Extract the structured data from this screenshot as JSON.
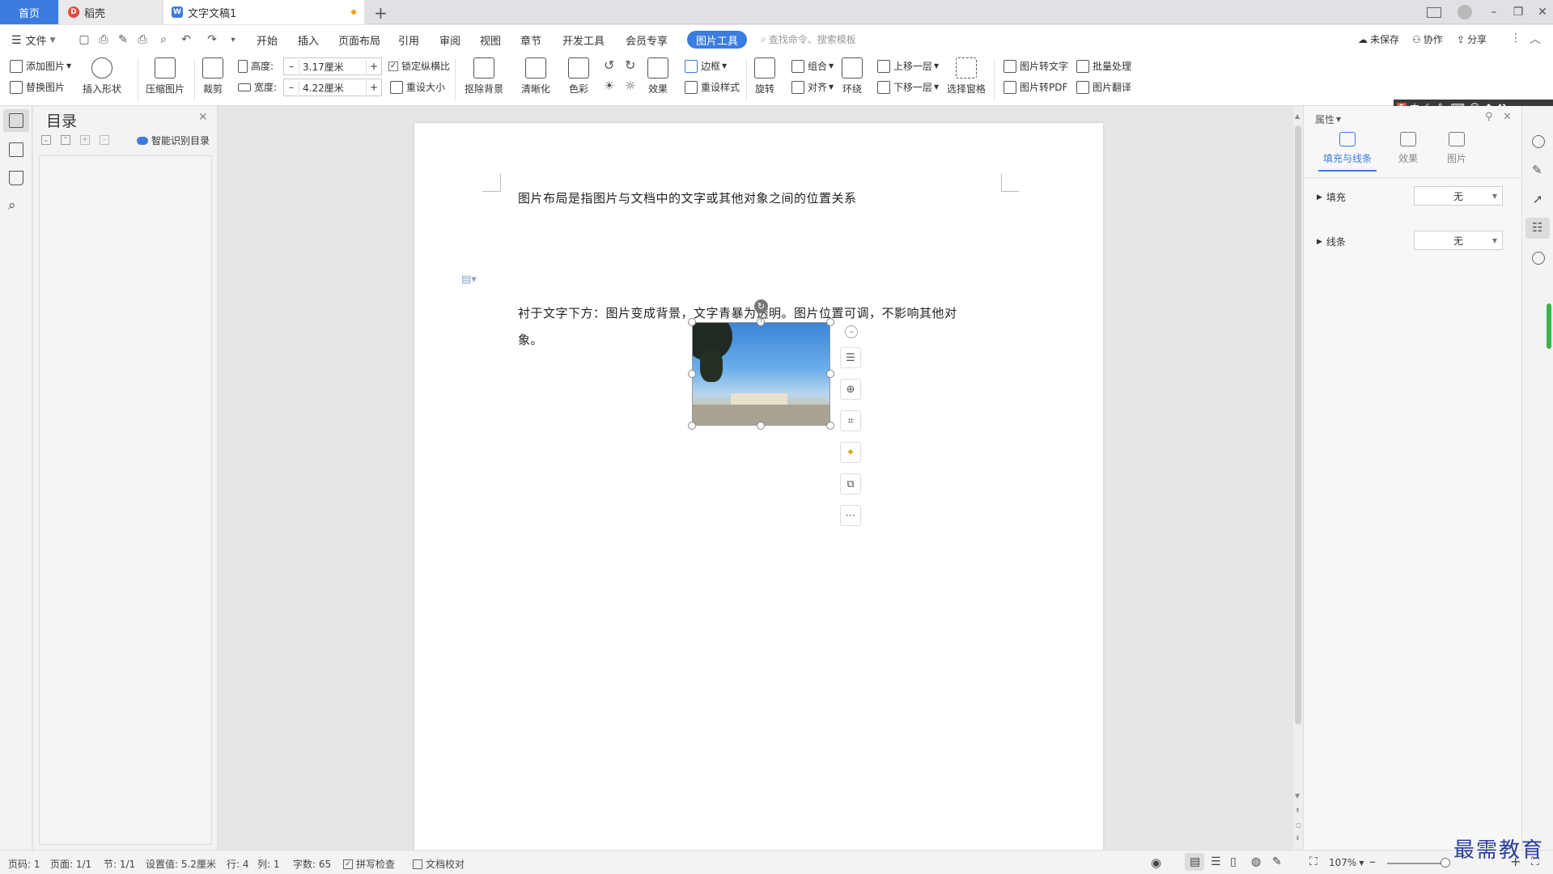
{
  "tabs": {
    "home": "首页",
    "daoke": "稻壳",
    "doc": "文字文稿1"
  },
  "menu": {
    "file": "文件",
    "items": [
      "开始",
      "插入",
      "页面布局",
      "引用",
      "审阅",
      "视图",
      "章节",
      "开发工具",
      "会员专享"
    ],
    "picture_tools": "图片工具",
    "search_placeholder": "查找命令、搜索模板",
    "unsaved": "未保存",
    "collab": "协作",
    "share": "分享"
  },
  "ribbon": {
    "add_picture": "添加图片",
    "replace_picture": "替换图片",
    "insert_shape": "插入形状",
    "compress_picture": "压缩图片",
    "crop": "裁剪",
    "height_label": "高度:",
    "height_value": "3.17厘米",
    "width_label": "宽度:",
    "width_value": "4.22厘米",
    "lock_ratio": "锁定纵横比",
    "reset_size": "重设大小",
    "remove_bg": "抠除背景",
    "sharpen": "清晰化",
    "color": "色彩",
    "effects": "效果",
    "border": "边框",
    "reset_style": "重设样式",
    "rotate": "旋转",
    "group": "组合",
    "align": "对齐",
    "wrap": "环绕",
    "bring_forward": "上移一层",
    "send_backward": "下移一层",
    "selection_pane": "选择窗格",
    "pic_to_text": "图片转文字",
    "batch_process": "批量处理",
    "pic_to_pdf": "图片转PDF",
    "pic_translate": "图片翻译"
  },
  "ime": {
    "label": "中"
  },
  "toc": {
    "title": "目录",
    "smart_toc": "智能识别目录"
  },
  "document": {
    "line1": "图片布局是指图片与文档中的文字或其他对象之间的位置关系",
    "para2_line1": "衬于文字下方：图片变成背景，文字青暴为透明。图片位置可调，不影响其他对",
    "para2_line2": "象。"
  },
  "props": {
    "title": "属性",
    "tab_fill_line": "填充与线条",
    "tab_effects": "效果",
    "tab_picture": "图片",
    "fill_label": "填充",
    "fill_value": "无",
    "line_label": "线条",
    "line_value": "无"
  },
  "status": {
    "page_code": "页码: 1",
    "pages": "页面: 1/1",
    "section": "节: 1/1",
    "setting": "设置值: 5.2厘米",
    "row": "行: 4",
    "col": "列: 1",
    "word_count": "字数: 65",
    "spell_check": "拼写检查",
    "doc_proof": "文档校对",
    "zoom": "107%"
  },
  "watermark": "最需教育",
  "colors": {
    "accent": "#3a7ce0",
    "wps_red": "#e24b3b"
  }
}
